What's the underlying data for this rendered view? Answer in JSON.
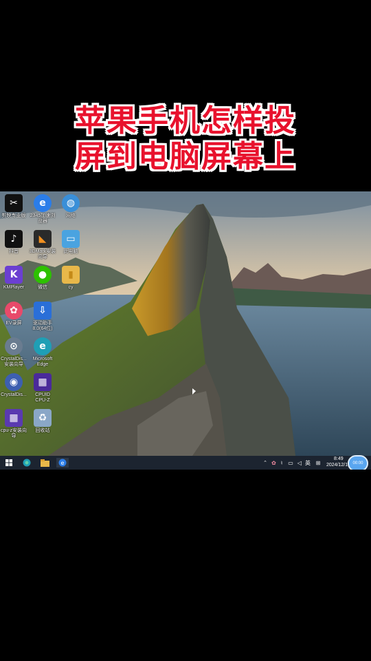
{
  "overlay": {
    "line1": "苹果手机怎样投",
    "line2": "屏到电脑屏幕上"
  },
  "desktop_icons": [
    {
      "name": "capcut-icon",
      "label": "剪映专业版",
      "bg": "#111111",
      "glyph": "✂"
    },
    {
      "name": "2345-browser-icon",
      "label": "2345加速浏\n览器",
      "bg": "#2b7de9",
      "glyph": "e"
    },
    {
      "name": "network-icon",
      "label": "网络",
      "bg": "#3a8fd8",
      "glyph": "◍"
    },
    {
      "name": "tiktok-icon",
      "label": "抖音",
      "bg": "#111111",
      "glyph": "♪"
    },
    {
      "name": "3dmark-icon",
      "label": "3DMark安装\n向导",
      "bg": "#2a2a2a",
      "glyph": "◣"
    },
    {
      "name": "this-pc-icon",
      "label": "此电脑",
      "bg": "#4aa3e0",
      "glyph": "▭"
    },
    {
      "name": "kmplayer-icon",
      "label": "KMPlayer",
      "bg": "#6b3fd1",
      "glyph": "K"
    },
    {
      "name": "wechat-icon",
      "label": "微信",
      "bg": "#2dc100",
      "glyph": "●"
    },
    {
      "name": "folder-icon",
      "label": "cy",
      "bg": "#e8b84a",
      "glyph": "▮"
    },
    {
      "name": "ev-recorder-icon",
      "label": "EV录屏",
      "bg": "#e84a6a",
      "glyph": "✿"
    },
    {
      "name": "driver-assistant-icon",
      "label": "驱动助手\n8.0(64位)",
      "bg": "#2a6fd8",
      "glyph": "⇩"
    },
    {
      "name": "crystaldisk-setup-icon",
      "label": "CrystalDis...\n安装向导",
      "bg": "#6a7c90",
      "glyph": "⊙"
    },
    {
      "name": "edge-icon",
      "label": "Microsoft\nEdge",
      "bg": "#1f9fb5",
      "glyph": "e"
    },
    {
      "name": "crystaldisk-icon",
      "label": "CrystalDis...",
      "bg": "#3d5fb0",
      "glyph": "◉"
    },
    {
      "name": "cpuid-icon",
      "label": "CPUID\nCPU-Z",
      "bg": "#4a2a9a",
      "glyph": "▦"
    },
    {
      "name": "cpuz-setup-icon",
      "label": "cpu-z安装向\n导",
      "bg": "#5a3ab0",
      "glyph": "▦"
    },
    {
      "name": "recycle-bin-icon",
      "label": "回收站",
      "bg": "#8aa7c7",
      "glyph": "♻"
    }
  ],
  "taskbar": {
    "pinned": [
      "windows-start-icon",
      "edge-taskbar-icon",
      "file-explorer-icon",
      "ie-browser-icon"
    ],
    "tray": {
      "ime": "英",
      "time": "8:49",
      "date": "2024/12/1",
      "badge": "00:00"
    }
  },
  "colors": {
    "title_red": "#e8122d",
    "taskbar": "#1c2430",
    "badge_blue": "#5aa6f0"
  }
}
